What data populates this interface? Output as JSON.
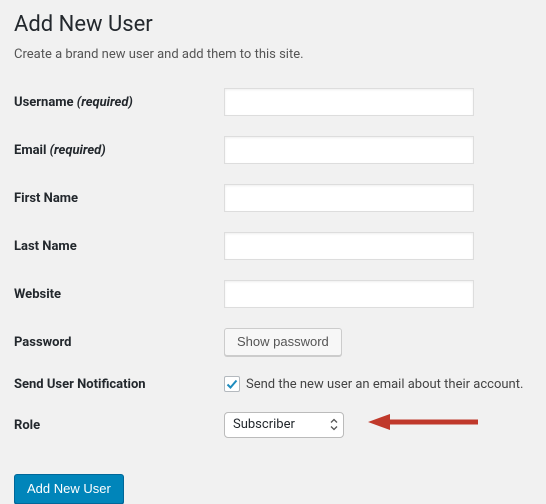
{
  "page": {
    "title": "Add New User",
    "description": "Create a brand new user and add them to this site."
  },
  "fields": {
    "username": {
      "label": "Username",
      "required_suffix": "(required)",
      "value": ""
    },
    "email": {
      "label": "Email",
      "required_suffix": "(required)",
      "value": ""
    },
    "first_name": {
      "label": "First Name",
      "value": ""
    },
    "last_name": {
      "label": "Last Name",
      "value": ""
    },
    "website": {
      "label": "Website",
      "value": ""
    },
    "password": {
      "label": "Password",
      "button": "Show password"
    },
    "send_notification": {
      "label": "Send User Notification",
      "checkbox_label": "Send the new user an email about their account.",
      "checked": true
    },
    "role": {
      "label": "Role",
      "selected": "Subscriber"
    }
  },
  "actions": {
    "submit": "Add New User"
  },
  "colors": {
    "accent": "#0085ba",
    "check": "#1e8cbe",
    "arrow": "#c0392b"
  }
}
